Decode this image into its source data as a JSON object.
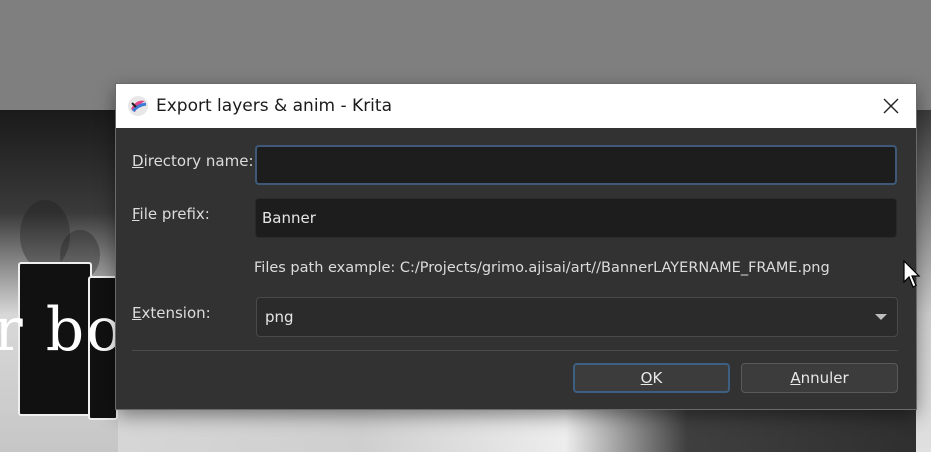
{
  "window": {
    "title": "Export layers & anim - Krita",
    "app_icon": "krita-icon",
    "close_icon": "close-icon"
  },
  "form": {
    "directory_label_mnemonic": "D",
    "directory_label_rest": "irectory name:",
    "directory_value": "",
    "prefix_label_mnemonic": "F",
    "prefix_label_rest": "ile prefix:",
    "prefix_value": "Banner",
    "path_example": "Files path example: C:/Projects/grimo.ajisai/art//BannerLAYERNAME_FRAME.png",
    "extension_label_mnemonic": "E",
    "extension_label_rest": "xtension:",
    "extension_value": "png"
  },
  "buttons": {
    "ok_mnemonic": "O",
    "ok_rest": "K",
    "cancel_mnemonic": "A",
    "cancel_rest": "nnuler"
  },
  "colors": {
    "dialog_bg": "#323232",
    "focus_border": "#3e5a78"
  },
  "background_art": {
    "text": "r bo"
  }
}
